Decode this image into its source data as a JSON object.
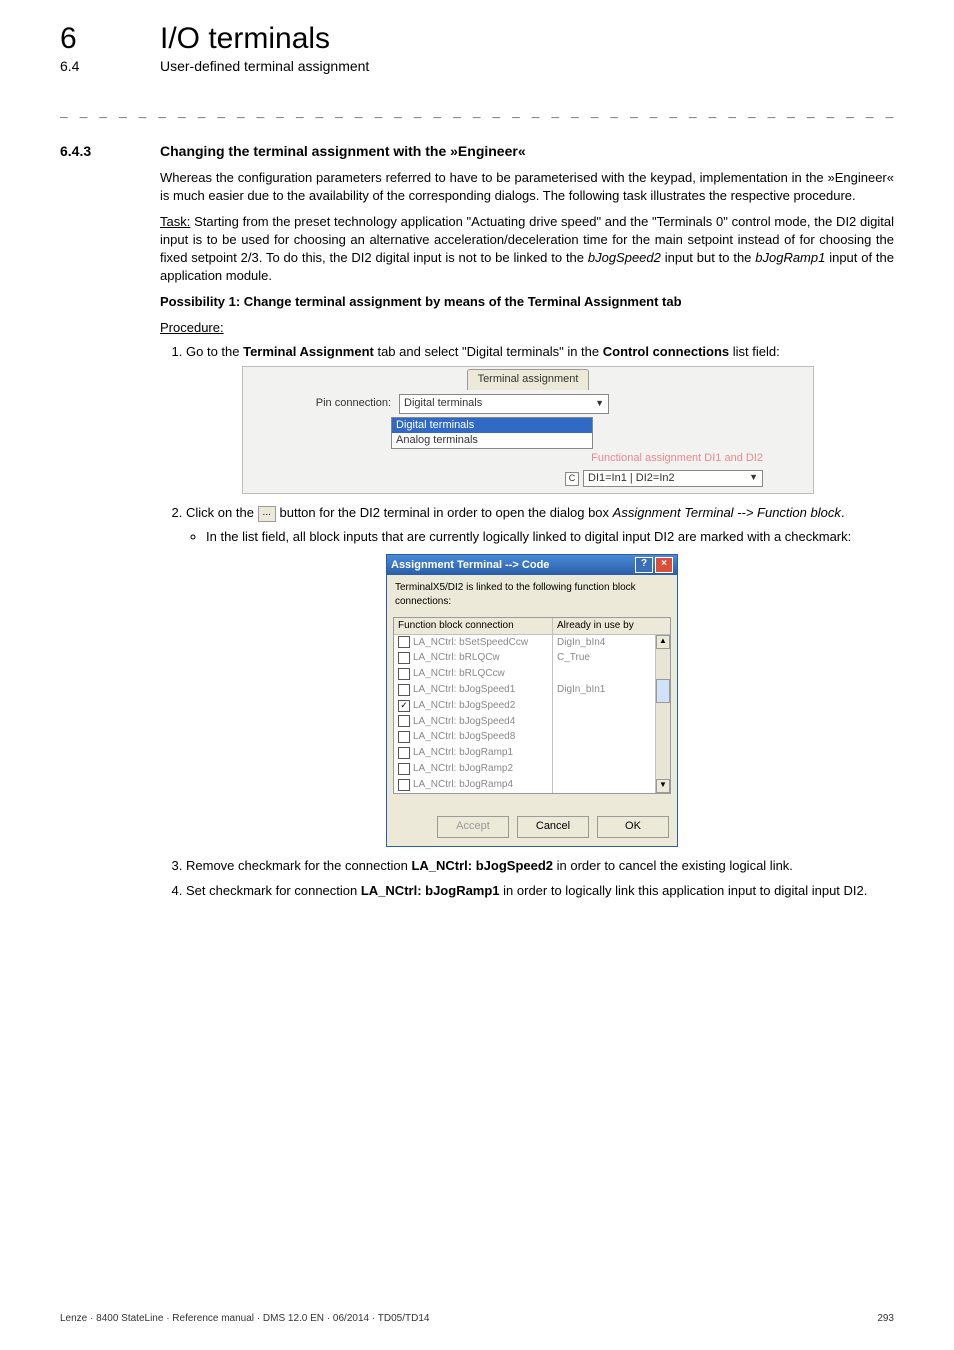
{
  "chapter": {
    "num": "6",
    "title": "I/O terminals"
  },
  "section": {
    "num": "6.4",
    "title": "User-defined terminal assignment"
  },
  "rule": "_ _ _ _ _ _ _ _ _ _ _ _ _ _ _ _ _ _ _ _ _ _ _ _ _ _ _ _ _ _ _ _ _ _ _ _ _ _ _ _ _ _ _ _ _ _ _ _ _ _ _ _ _ _ _ _ _ _ _ _ _ _ _",
  "h3": {
    "num": "6.4.3",
    "title": "Changing the terminal assignment with the »Engineer«"
  },
  "intro_para": "Whereas the configuration parameters referred to have to be parameterised with the keypad, implementation in the »Engineer« is much easier due to the availability of the corresponding dialogs. The following task illustrates the respective procedure.",
  "task": {
    "label": "Task:",
    "text_a": " Starting from the preset technology application \"Actuating drive speed\" and the \"Terminals 0\" control mode, the DI2 digital input is to be used for choosing an alternative acceleration/deceleration time for the main setpoint instead of for choosing the fixed setpoint 2/3. To do this, the DI2 digital input is not to be linked to the ",
    "i1": "bJogSpeed2",
    "mid": " input but to the ",
    "i2": "bJogRamp1",
    "text_b": " input of the application module."
  },
  "possibility1": "Possibility 1: Change terminal assignment by means of the Terminal Assignment tab",
  "procedure_label": "Procedure:",
  "step1": {
    "a": "Go to the ",
    "b": "Terminal Assignment",
    "c": " tab and select \"Digital terminals\" in the ",
    "d": "Control connections",
    "e": " list field:"
  },
  "shot1": {
    "tab": "Terminal assignment",
    "pin_label": "Pin connection:",
    "selected": "Digital terminals",
    "opt_digital": "Digital terminals",
    "opt_analog": "Analog terminals",
    "fa_label": "Functional assignment DI1 and DI2",
    "c_letter": "C",
    "fa_value": "DI1=In1 | DI2=In2"
  },
  "step2": {
    "a": "Click on the ",
    "btn": "...",
    "b": " button for the DI2 terminal in order to open the dialog box ",
    "i1": "Assignment Terminal --> Function block",
    "dot": "."
  },
  "step2_bullet": "In the list field, all block inputs that are currently logically linked to digital input DI2 are marked with a checkmark:",
  "shot2": {
    "title": "Assignment Terminal --> Code",
    "desc": "TerminalX5/DI2 is linked to the following function block connections:",
    "col1": "Function block connection",
    "col2": "Already in use by",
    "rows": [
      {
        "label": "LA_NCtrl: bSetSpeedCcw",
        "used": "DigIn_bIn4",
        "checked": false
      },
      {
        "label": "LA_NCtrl: bRLQCw",
        "used": "C_True",
        "checked": false
      },
      {
        "label": "LA_NCtrl: bRLQCcw",
        "used": "",
        "checked": false
      },
      {
        "label": "LA_NCtrl: bJogSpeed1",
        "used": "DigIn_bIn1",
        "checked": false
      },
      {
        "label": "LA_NCtrl: bJogSpeed2",
        "used": "",
        "checked": true
      },
      {
        "label": "LA_NCtrl: bJogSpeed4",
        "used": "",
        "checked": false
      },
      {
        "label": "LA_NCtrl: bJogSpeed8",
        "used": "",
        "checked": false
      },
      {
        "label": "LA_NCtrl: bJogRamp1",
        "used": "",
        "checked": false
      },
      {
        "label": "LA_NCtrl: bJogRamp2",
        "used": "",
        "checked": false
      },
      {
        "label": "LA_NCtrl: bJogRamp4",
        "used": "",
        "checked": false
      }
    ],
    "accept": "Accept",
    "cancel": "Cancel",
    "ok": "OK"
  },
  "step3": {
    "a": "Remove checkmark for the connection ",
    "b": "LA_NCtrl: bJogSpeed2",
    "c": " in order to cancel the existing logical link."
  },
  "step4": {
    "a": "Set checkmark for connection ",
    "b": "LA_NCtrl: bJogRamp1",
    "c": " in order to logically link this application input to digital input DI2."
  },
  "footer": {
    "left": "Lenze · 8400 StateLine · Reference manual · DMS 12.0 EN · 06/2014 · TD05/TD14",
    "right": "293"
  }
}
